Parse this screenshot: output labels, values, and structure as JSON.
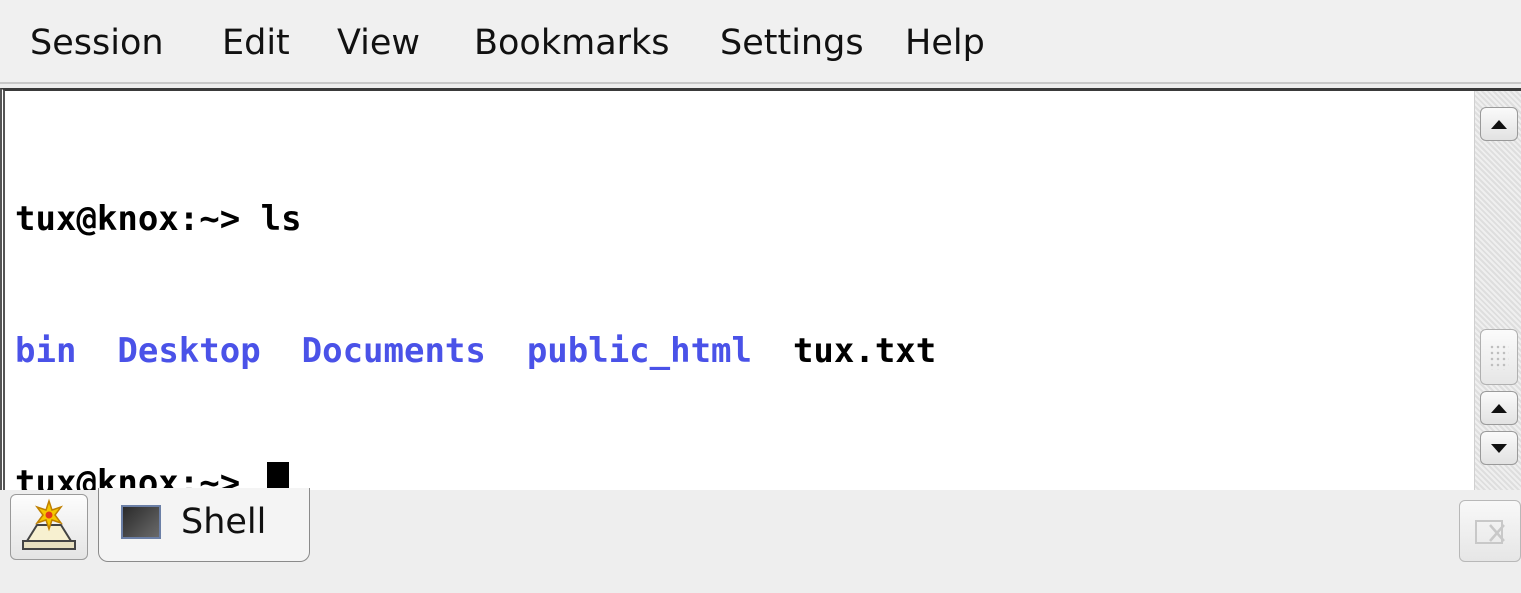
{
  "menubar": {
    "items": [
      "Session",
      "Edit",
      "View",
      "Bookmarks",
      "Settings",
      "Help"
    ]
  },
  "terminal": {
    "line1": {
      "prompt": "tux@knox:~>",
      "command": " ls"
    },
    "line2": {
      "entries": [
        {
          "text": "bin",
          "type": "dir"
        },
        {
          "text": "Desktop",
          "type": "dir"
        },
        {
          "text": "Documents",
          "type": "dir"
        },
        {
          "text": "public_html",
          "type": "dir"
        },
        {
          "text": "tux.txt",
          "type": "file"
        }
      ]
    },
    "line3": {
      "prompt": "tux@knox:~>"
    },
    "colors": {
      "directory": "#4a52e8",
      "file": "#000000",
      "background": "#ffffff"
    }
  },
  "tabs": {
    "new_session_icon": "new-session-icon",
    "items": [
      {
        "label": "Shell",
        "icon": "terminal-icon"
      }
    ],
    "close_icon": "close-tab-icon"
  }
}
